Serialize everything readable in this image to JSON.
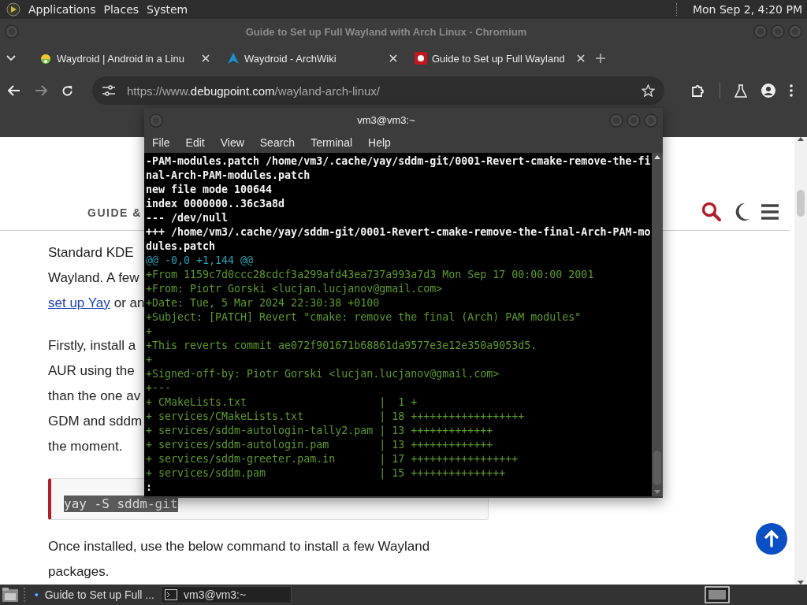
{
  "top_panel": {
    "menus": [
      "Applications",
      "Places",
      "System"
    ],
    "clock": "Mon Sep 2, 4:20 PM"
  },
  "browser": {
    "title": "Guide to Set up Full Wayland with Arch Linux - Chromium",
    "tabs": [
      {
        "label": "Waydroid | Android in a Linu",
        "kind": "waydroid"
      },
      {
        "label": "Waydroid - ArchWiki",
        "kind": "arch"
      },
      {
        "label": "Guide to Set up Full Wayland",
        "kind": "record"
      }
    ],
    "url": "https://www.**debugpoint.com**/wayland-arch-linux/",
    "page": {
      "nav_label": "GUIDE &",
      "paragraphs": [
        {
          "lines": [
            [
              {
                "kind": "text",
                "text": "Standard KDE"
              }
            ],
            [
              {
                "kind": "text",
                "text": "Wayland. A few"
              }
            ],
            [
              {
                "kind": "link",
                "text": "set up Yay"
              },
              {
                "kind": "text",
                "text": "or an"
              }
            ]
          ]
        },
        {
          "lines": [
            [
              {
                "kind": "text",
                "text": "Firstly, install a"
              }
            ],
            [
              {
                "kind": "text",
                "text": "AUR using the"
              }
            ],
            [
              {
                "kind": "text",
                "text": "than the one av"
              }
            ],
            [
              {
                "kind": "text",
                "text": "GDM and sddm"
              }
            ],
            [
              {
                "kind": "text",
                "text": "the moment."
              }
            ]
          ]
        }
      ],
      "code": "yay -S sddm-git",
      "after": {
        "lines": [
          [
            {
              "kind": "text",
              "text": "Once installed, use the below command to install a few Wayland"
            }
          ],
          [
            {
              "kind": "text",
              "text": "packages."
            }
          ]
        ]
      }
    }
  },
  "terminal": {
    "title": "vm3@vm3:~",
    "menus": [
      "File",
      "Edit",
      "View",
      "Search",
      "Terminal",
      "Help"
    ],
    "lines": [
      {
        "kind": "header",
        "text": "-PAM-modules.patch /home/vm3/.cache/yay/sddm-git/0001-Revert-cmake-remove-the-fi"
      },
      {
        "kind": "header",
        "text": "nal-Arch-PAM-modules.patch"
      },
      {
        "kind": "header",
        "text": "new file mode 100644"
      },
      {
        "kind": "header",
        "text": "index 0000000..36c3a8d"
      },
      {
        "kind": "header",
        "text": "--- /dev/null"
      },
      {
        "kind": "header",
        "text": "+++ /home/vm3/.cache/yay/sddm-git/0001-Revert-cmake-remove-the-final-Arch-PAM-mo"
      },
      {
        "kind": "header",
        "text": "dules.patch"
      },
      {
        "kind": "hunk",
        "text": "@@ -0,0 +1,144 @@"
      },
      {
        "kind": "added",
        "text": "+From 1159c7d0ccc28cdcf3a299afd43ea737a993a7d3 Mon Sep 17 00:00:00 2001"
      },
      {
        "kind": "added",
        "text": "+From: Piotr Gorski <lucjan.lucjanov@gmail.com>"
      },
      {
        "kind": "added",
        "text": "+Date: Tue, 5 Mar 2024 22:30:38 +0100"
      },
      {
        "kind": "added",
        "text": "+Subject: [PATCH] Revert \"cmake: remove the final (Arch) PAM modules\""
      },
      {
        "kind": "added",
        "text": "+"
      },
      {
        "kind": "added",
        "text": "+This reverts commit ae072f901671b68861da9577e3e12e350a9053d5."
      },
      {
        "kind": "added",
        "text": "+"
      },
      {
        "kind": "added",
        "text": "+Signed-off-by: Piotr Gorski <lucjan.lucjanov@gmail.com>"
      },
      {
        "kind": "added",
        "text": "+---"
      },
      {
        "kind": "added",
        "text": "+ CMakeLists.txt                     |  1 +"
      },
      {
        "kind": "added",
        "text": "+ services/CMakeLists.txt            | 18 ++++++++++++++++++"
      },
      {
        "kind": "added",
        "text": "+ services/sddm-autologin-tally2.pam | 13 +++++++++++++"
      },
      {
        "kind": "added",
        "text": "+ services/sddm-autologin.pam        | 13 +++++++++++++"
      },
      {
        "kind": "added",
        "text": "+ services/sddm-greeter.pam.in       | 17 +++++++++++++++++"
      },
      {
        "kind": "added",
        "text": "+ services/sddm.pam                  | 15 +++++++++++++++"
      },
      {
        "kind": "prompt",
        "text": ":"
      }
    ]
  },
  "taskbar": {
    "items": [
      {
        "label": "Guide to Set up Full ...",
        "kind": "browser",
        "selected": false
      },
      {
        "label": "vm3@vm3:~",
        "kind": "terminal",
        "selected": true
      }
    ]
  }
}
